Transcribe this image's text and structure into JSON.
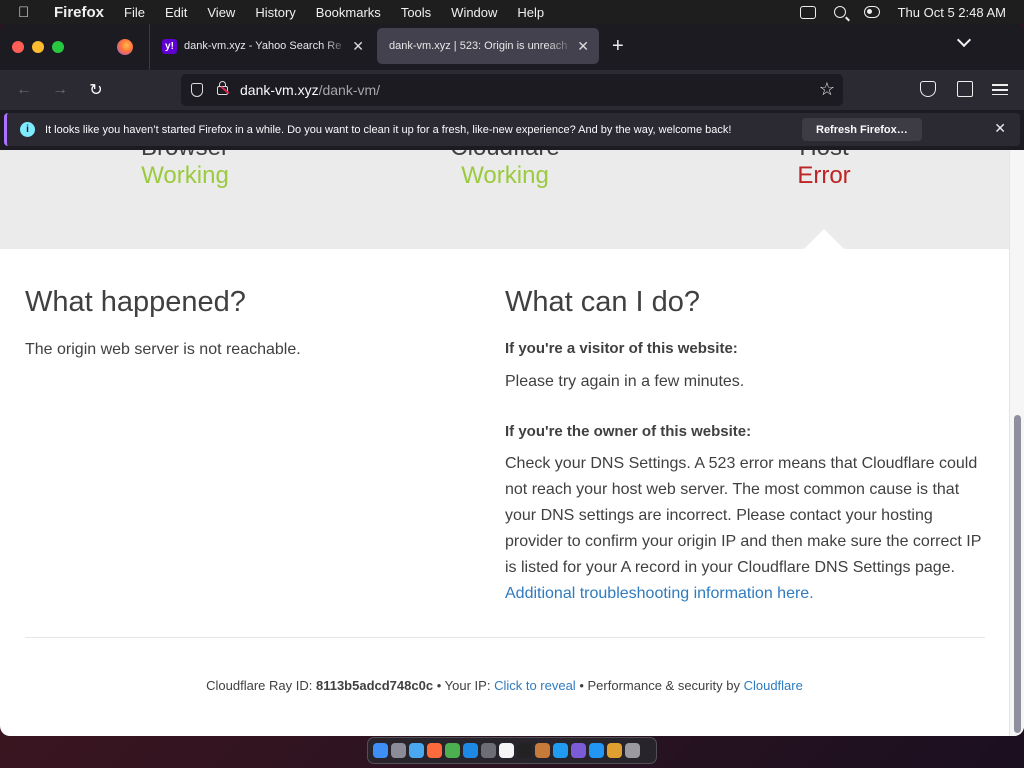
{
  "menubar": {
    "app_name": "Firefox",
    "items": [
      "File",
      "Edit",
      "View",
      "History",
      "Bookmarks",
      "Tools",
      "Window",
      "Help"
    ],
    "datetime": "Thu Oct 5  2:48 AM"
  },
  "tabs": [
    {
      "favicon": "y!",
      "title": "dank-vm.xyz - Yahoo Search Re",
      "close": "✕"
    },
    {
      "title": "dank-vm.xyz | 523: Origin is unreach",
      "close": "✕"
    }
  ],
  "new_tab": "+",
  "url": {
    "host": "dank-vm.xyz",
    "path": "/dank-vm/"
  },
  "nav": {
    "back": "←",
    "forward": "→",
    "reload": "↻",
    "star": "☆"
  },
  "notification": {
    "icon": "i",
    "message": "It looks like you haven’t started Firefox in a while. Do you want to clean it up for a fresh, like-new experience? And by the way, welcome back!",
    "button": "Refresh Firefox…",
    "close": "✕"
  },
  "status": [
    {
      "name_cut": "Browser",
      "state": "Working"
    },
    {
      "name_cut": "Cloudflare",
      "state": "Working"
    },
    {
      "name_cut": "Host",
      "state": "Error"
    }
  ],
  "left": {
    "heading": "What happened?",
    "text": "The origin web server is not reachable."
  },
  "right": {
    "heading": "What can I do?",
    "visitor_label": "If you're a visitor of this website:",
    "visitor_text": "Please try again in a few minutes.",
    "owner_label": "If you're the owner of this website:",
    "owner_text": "Check your DNS Settings. A 523 error means that Cloudflare could not reach your host web server. The most common cause is that your DNS settings are incorrect. Please contact your hosting provider to confirm your origin IP and then make sure the correct IP is listed for your A record in your Cloudflare DNS Settings page.",
    "owner_link": "Additional troubleshooting information here."
  },
  "footer": {
    "ray_label": "Cloudflare Ray ID:",
    "ray_id": "8113b5adcd748c0c",
    "sep": "•",
    "ip_label": "Your IP:",
    "ip_link": "Click to reveal",
    "perf_label": "Performance & security by",
    "perf_link": "Cloudflare"
  },
  "colors": {
    "working": "#9bca3e",
    "error": "#bd2426",
    "link": "#2f7bbf"
  }
}
